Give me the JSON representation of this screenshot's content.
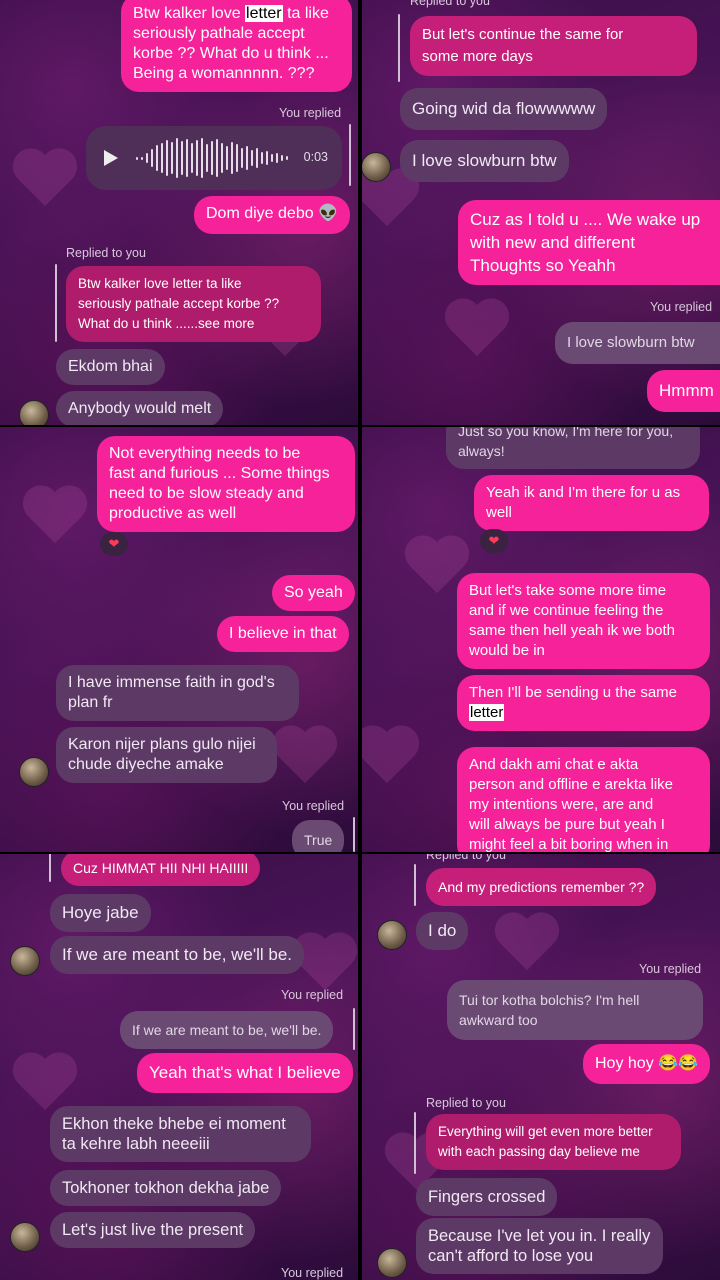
{
  "panel1": {
    "top_msg": "Btw kalker love ",
    "top_hl": "letter",
    "top_rest": " ta like\nseriously pathale accept\nkorbe ?? What do u think ...\nBeing a womannnnn. ???",
    "you_replied": "You replied",
    "voice_duration": "0:03",
    "dom": "Dom diye debo 👽",
    "replied_to_you": "Replied to you",
    "quote": "Btw kalker love letter ta like\nseriously pathale accept korbe ??\nWhat do u think ......see more",
    "m1": "Ekdom bhai",
    "m2": "Anybody would melt"
  },
  "panel2": {
    "replied_to_you": "Replied to you",
    "quote": "But let's continue the same for\nsome more days",
    "m1": "Going wid da flowwwww",
    "m2": "I love slowburn btw",
    "m3": "Cuz as I told u .... We wake up\nwith new and different\nThoughts so Yeahh",
    "you_replied": "You replied",
    "quote2": "I love slowburn btw",
    "m4": "Hmmm"
  },
  "panel3": {
    "m1": "Not everything needs to be\nfast and furious ... Some things\nneed to be slow steady and\nproductive as well",
    "reaction": "❤",
    "m2": "So yeah",
    "m3": "I believe in that",
    "m4": "I have immense faith in god's\nplan fr",
    "m5": "Karon nijer plans gulo nijei\nchude diyeche amake",
    "you_replied": "You replied",
    "quote": "True"
  },
  "panel4": {
    "m0": "Just so you know, I'm here for you,\nalways!",
    "m1": "Yeah ik and I'm there for u as\nwell",
    "reaction": "❤",
    "m2": "But let's take some more time\nand if we continue feeling the\nsame then hell yeah ik we both\nwould be in",
    "m3a": "Then I'll be sending u the same\n",
    "m3hl": "letter",
    "m4": "And dakh ami chat e akta\nperson and offline e arekta like\nmy intentions were, are and\nwill always be pure but yeah I\nmight feel a bit boring when in"
  },
  "panel5": {
    "quote_top": "Cuz HIMMAT HII NHI HAIIIII",
    "m1": "Hoye jabe",
    "m2": "If we are meant to be, we'll be.",
    "you_replied": "You replied",
    "quote": "If we are meant to be, we'll be.",
    "m3": "Yeah that's what I believe",
    "m4": "Ekhon theke bhebe ei moment\nta kehre labh neeeiii",
    "m5": "Tokhoner tokhon dekha jabe",
    "m6": "Let's just live the present",
    "you_replied2": "You replied"
  },
  "panel6": {
    "replied_to_you": "Replied to you",
    "quote": "And my predictions remember ??",
    "m1": "I do",
    "you_replied": "You replied",
    "quote2": "Tui tor kotha bolchis? I'm hell\nawkward too",
    "m2": "Hoy hoy 😂😂",
    "replied_to_you2": "Replied to you",
    "quote3": "Everything will get even more better\nwith each passing day believe me",
    "m3": "Fingers crossed",
    "m4": "Because I've let you in. I really\ncan't afford to lose you"
  }
}
